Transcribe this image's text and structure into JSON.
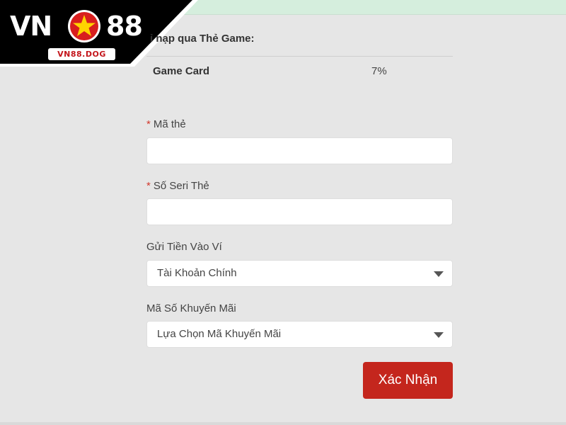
{
  "brand": {
    "logo_left": "VN",
    "logo_right": "88",
    "logo_domain": "VN88.DOG",
    "colors": {
      "primary_red": "#c4161c",
      "logo_bg": "#000000",
      "star": "#ffd400"
    }
  },
  "rate_section": {
    "title": "ỉ nạp qua Thẻ Game:",
    "rows": [
      {
        "name": "Game Card",
        "value": "7%"
      }
    ]
  },
  "form": {
    "required_mark": "*",
    "card_code": {
      "label": "Mã thẻ",
      "value": ""
    },
    "card_serial": {
      "label": "Số Seri Thẻ",
      "value": ""
    },
    "wallet": {
      "label": "Gửi Tiền Vào Ví",
      "selected": "Tài Khoản Chính",
      "icon": "chevron-down-icon"
    },
    "promo": {
      "label": "Mã Số Khuyến Mãi",
      "selected": "Lựa Chọn Mã Khuyến Mãi",
      "icon": "chevron-down-icon"
    },
    "submit_label": "Xác Nhận",
    "colors": {
      "submit_bg": "#c4261d",
      "required": "#d23a2e"
    }
  }
}
